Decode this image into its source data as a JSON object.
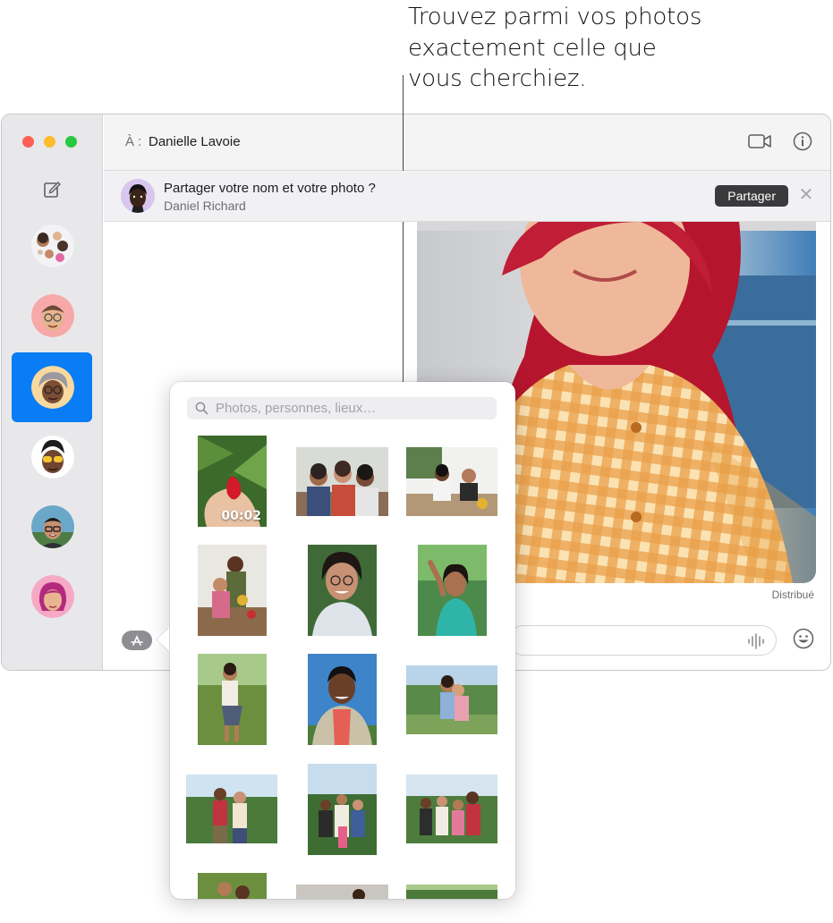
{
  "callout": {
    "lines": [
      "Trouvez parmi vos photos",
      "exactement celle que",
      "vous cherchiez."
    ]
  },
  "header": {
    "to_label": "À :",
    "to_name": "Danielle Lavoie"
  },
  "banner": {
    "title": "Partager votre nom et votre photo ?",
    "subtitle": "Daniel Richard",
    "share_label": "Partager",
    "close_glyph": "✕"
  },
  "conversation": {
    "status": "Distribué"
  },
  "photo_picker": {
    "search_placeholder": "Photos, personnes, lieux…",
    "video_duration": "00:02"
  },
  "colors": {
    "accent": "#0a7cf5",
    "traffic_red": "#fe5f57",
    "traffic_yellow": "#febc2e",
    "traffic_green": "#28c840"
  },
  "icons": [
    "compose-icon",
    "video-call-icon",
    "info-icon",
    "search-icon",
    "audio-waveform-icon",
    "emoji-icon",
    "app-store-icon",
    "close-icon"
  ]
}
